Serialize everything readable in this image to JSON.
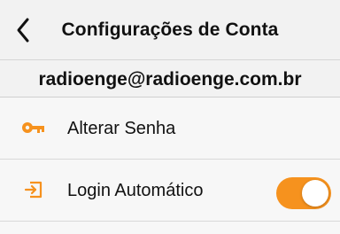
{
  "navbar": {
    "title": "Configurações de Conta",
    "back_icon": "chevron-left-icon"
  },
  "account": {
    "email": "radioenge@radioenge.com.br"
  },
  "settings": {
    "items": [
      {
        "label": "Alterar Senha",
        "icon": "key-icon"
      },
      {
        "label": "Login Automático",
        "icon": "login-icon",
        "toggle_on": true
      }
    ]
  },
  "colors": {
    "accent": "#f6921e",
    "background": "#f7f7f7",
    "navbar": "#f2f2f2"
  }
}
